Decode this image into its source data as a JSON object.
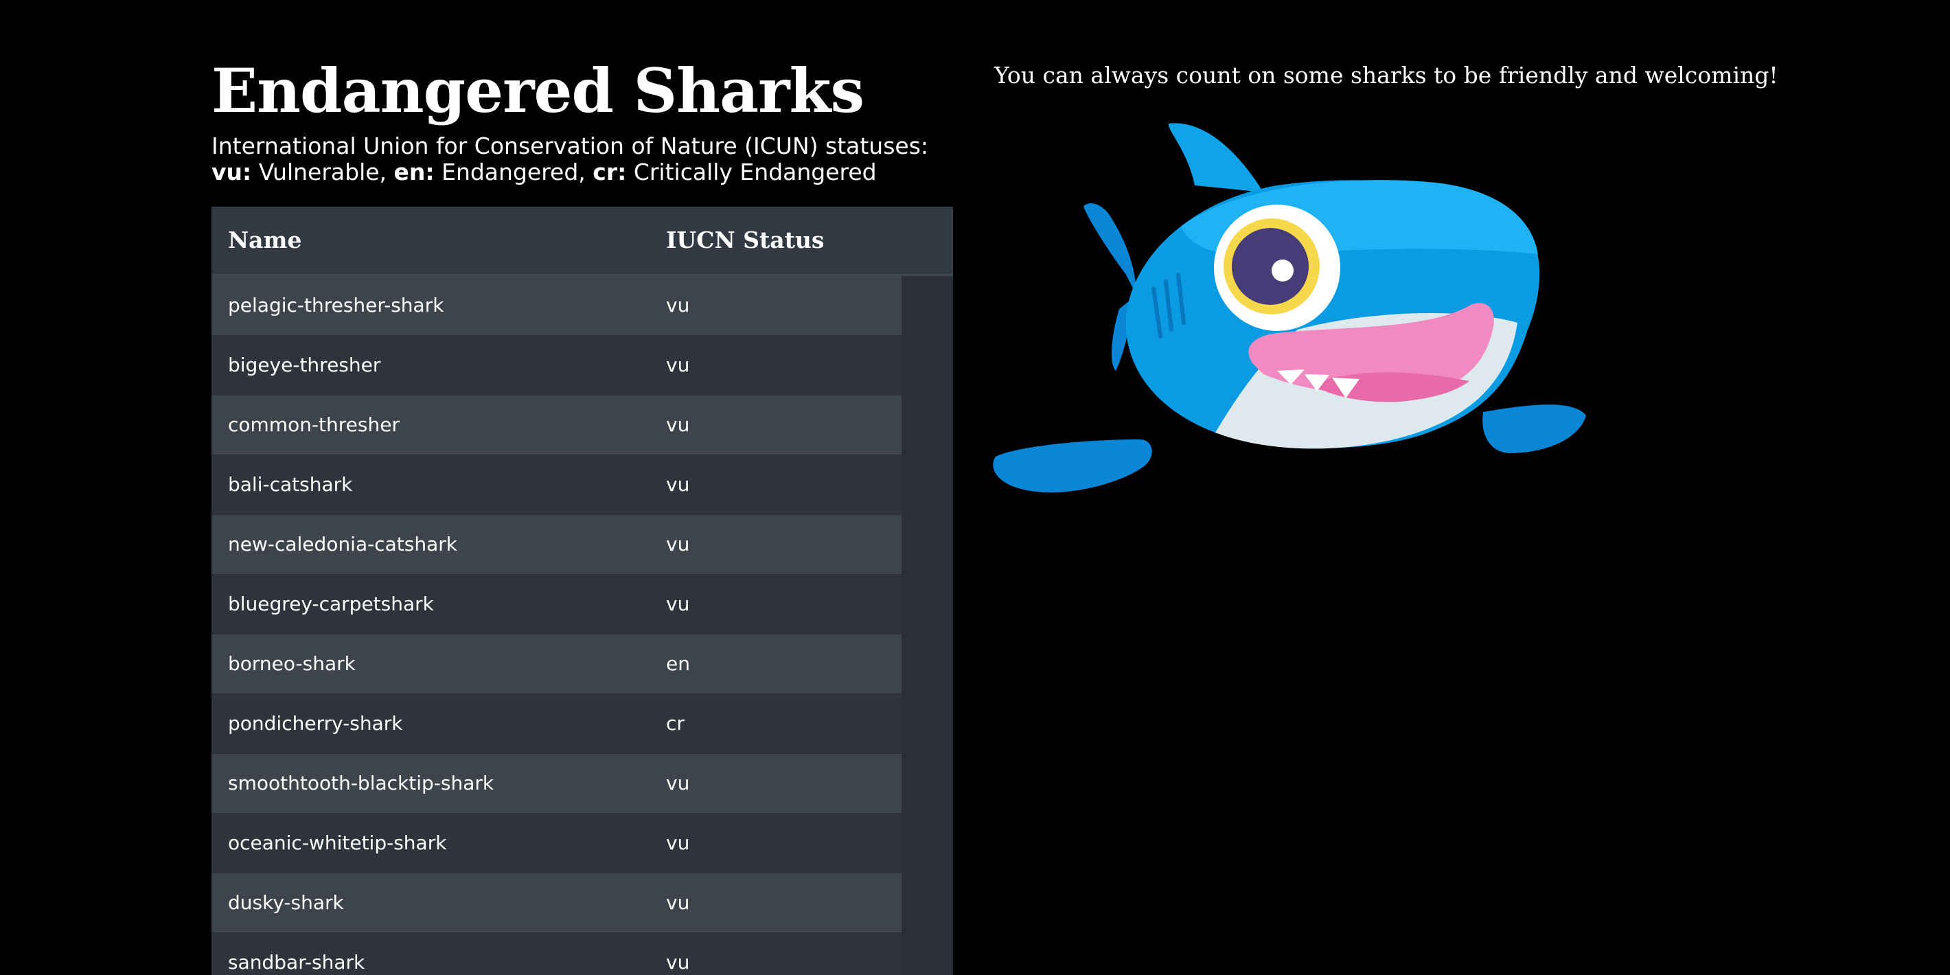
{
  "page": {
    "title": "Endangered Sharks",
    "legend_intro": "International Union for Conservation of Nature (ICUN) statuses:",
    "legend": [
      {
        "code": "vu:",
        "meaning": " Vulnerable, "
      },
      {
        "code": "en:",
        "meaning": " Endangered, "
      },
      {
        "code": "cr:",
        "meaning": " Critically Endangered"
      }
    ],
    "caption": "You can always count on some sharks to be friendly and welcoming!"
  },
  "table": {
    "headers": {
      "name": "Name",
      "status": "IUCN Status"
    },
    "rows": [
      {
        "name": "pelagic-thresher-shark",
        "status": "vu"
      },
      {
        "name": "bigeye-thresher",
        "status": "vu"
      },
      {
        "name": "common-thresher",
        "status": "vu"
      },
      {
        "name": "bali-catshark",
        "status": "vu"
      },
      {
        "name": "new-caledonia-catshark",
        "status": "vu"
      },
      {
        "name": "bluegrey-carpetshark",
        "status": "vu"
      },
      {
        "name": "borneo-shark",
        "status": "en"
      },
      {
        "name": "pondicherry-shark",
        "status": "cr"
      },
      {
        "name": "smoothtooth-blacktip-shark",
        "status": "vu"
      },
      {
        "name": "oceanic-whitetip-shark",
        "status": "vu"
      },
      {
        "name": "dusky-shark",
        "status": "vu"
      },
      {
        "name": "sandbar-shark",
        "status": "vu"
      }
    ]
  },
  "illustration": {
    "icon": "cartoon-shark-icon",
    "colors": {
      "body": "#0a9be3",
      "body_light": "#1fb2f5",
      "belly": "#dde9ec",
      "mouth": "#f08ac0",
      "eye_ring": "#f6d84a",
      "pupil": "#463d78"
    }
  }
}
